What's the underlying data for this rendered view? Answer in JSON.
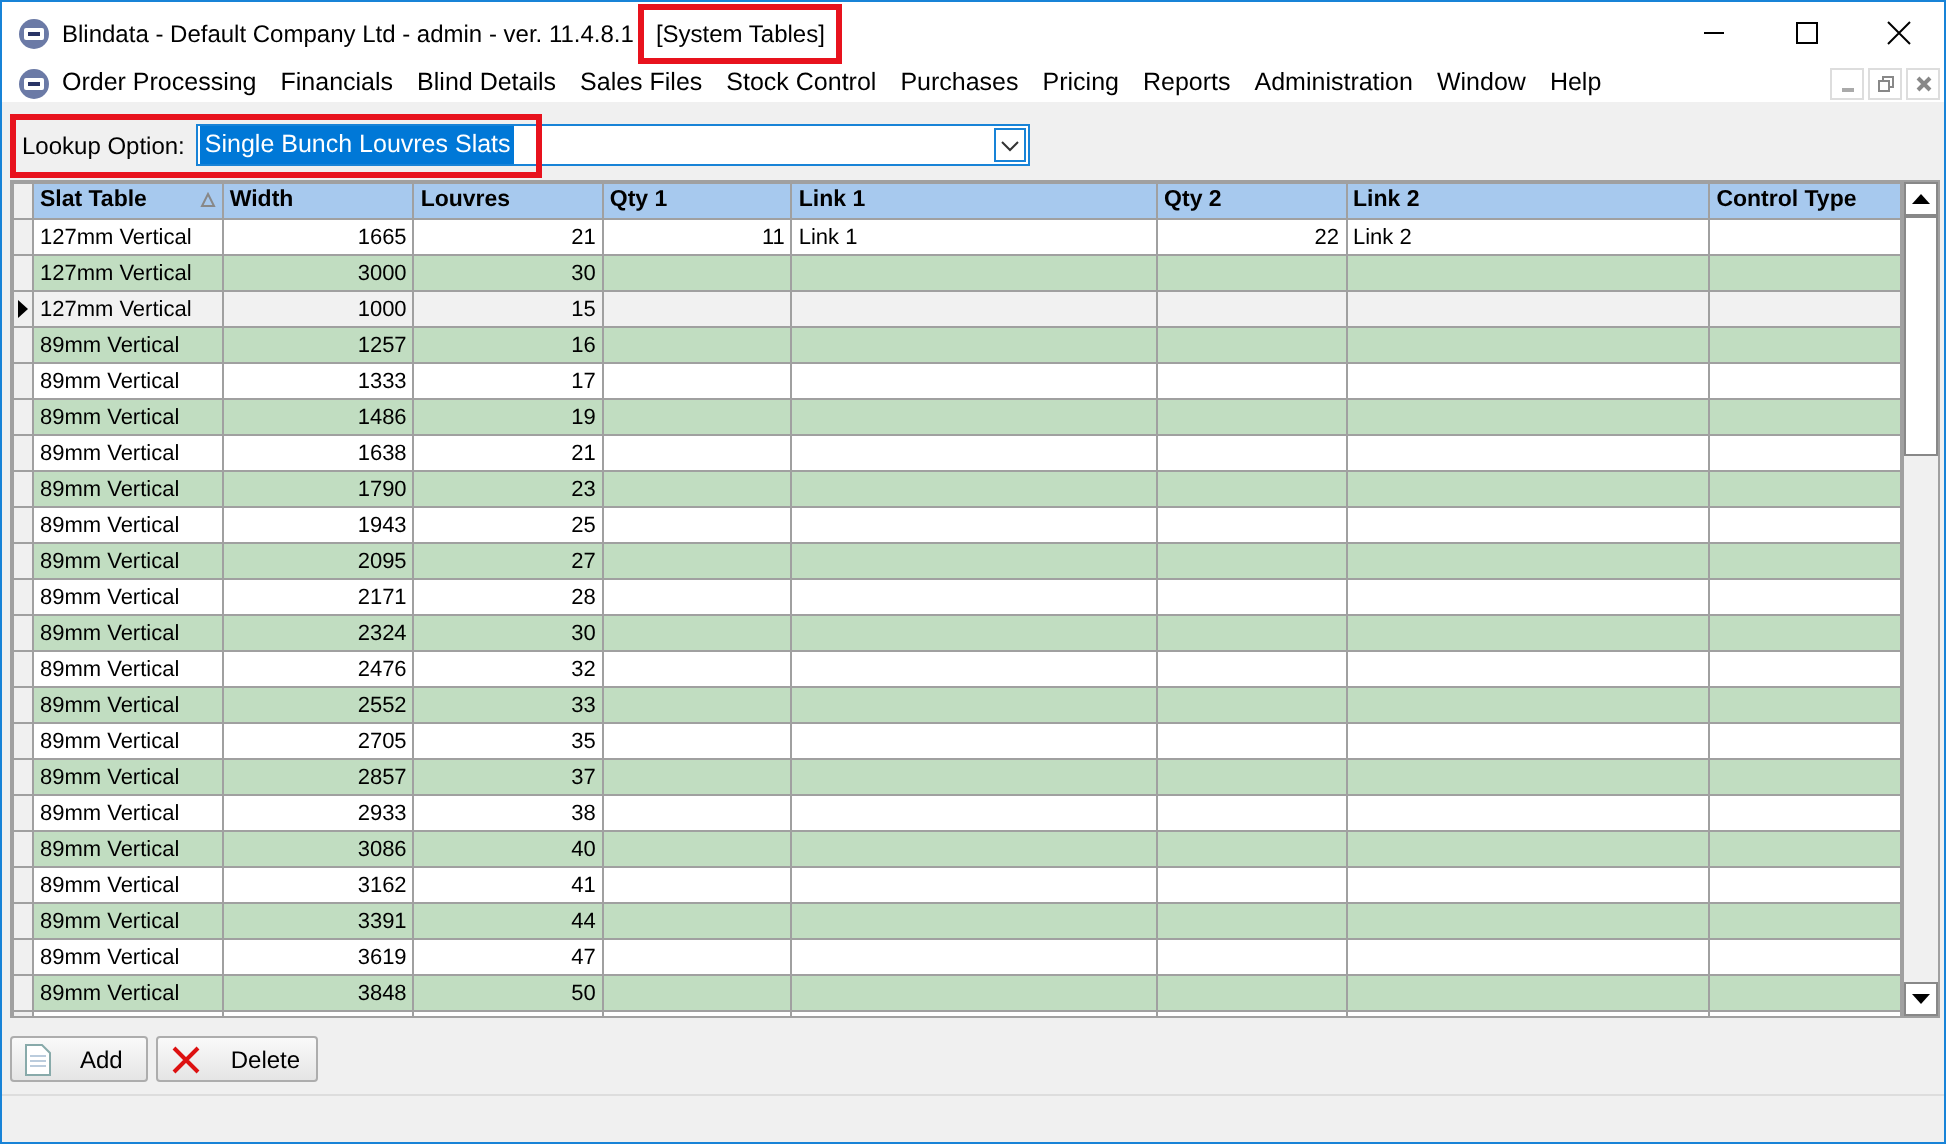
{
  "window": {
    "title": "Blindata - Default Company Ltd - admin - ver. 11.4.8.1",
    "title_tag": "[System Tables]",
    "title_tag_highlighted": true
  },
  "menu": [
    "Order Processing",
    "Financials",
    "Blind Details",
    "Sales Files",
    "Stock Control",
    "Purchases",
    "Pricing",
    "Reports",
    "Administration",
    "Window",
    "Help"
  ],
  "lookup": {
    "label": "Lookup Option:",
    "value": "Single Bunch Louvres Slats",
    "highlighted": true
  },
  "table": {
    "columns": [
      {
        "label": "Slat Table",
        "sorted": true
      },
      {
        "label": "Width",
        "sorted": false
      },
      {
        "label": "Louvres",
        "sorted": false
      },
      {
        "label": "Qty 1",
        "sorted": false
      },
      {
        "label": "Link 1",
        "sorted": false
      },
      {
        "label": "Qty 2",
        "sorted": false
      },
      {
        "label": "Link 2",
        "sorted": false
      },
      {
        "label": "Control Type",
        "sorted": false
      }
    ],
    "rows": [
      {
        "selected": false,
        "cells": [
          "127mm Vertical",
          "1665",
          "21",
          "11",
          "Link 1",
          "22",
          "Link 2"
        ]
      },
      {
        "selected": false,
        "cells": [
          "127mm Vertical",
          "3000",
          "30"
        ]
      },
      {
        "selected": true,
        "cells": [
          "127mm Vertical",
          "1000",
          "15"
        ]
      },
      {
        "selected": false,
        "cells": [
          "89mm Vertical",
          "1257",
          "16"
        ]
      },
      {
        "selected": false,
        "cells": [
          "89mm Vertical",
          "1333",
          "17"
        ]
      },
      {
        "selected": false,
        "cells": [
          "89mm Vertical",
          "1486",
          "19"
        ]
      },
      {
        "selected": false,
        "cells": [
          "89mm Vertical",
          "1638",
          "21"
        ]
      },
      {
        "selected": false,
        "cells": [
          "89mm Vertical",
          "1790",
          "23"
        ]
      },
      {
        "selected": false,
        "cells": [
          "89mm Vertical",
          "1943",
          "25"
        ]
      },
      {
        "selected": false,
        "cells": [
          "89mm Vertical",
          "2095",
          "27"
        ]
      },
      {
        "selected": false,
        "cells": [
          "89mm Vertical",
          "2171",
          "28"
        ]
      },
      {
        "selected": false,
        "cells": [
          "89mm Vertical",
          "2324",
          "30"
        ]
      },
      {
        "selected": false,
        "cells": [
          "89mm Vertical",
          "2476",
          "32"
        ]
      },
      {
        "selected": false,
        "cells": [
          "89mm Vertical",
          "2552",
          "33"
        ]
      },
      {
        "selected": false,
        "cells": [
          "89mm Vertical",
          "2705",
          "35"
        ]
      },
      {
        "selected": false,
        "cells": [
          "89mm Vertical",
          "2857",
          "37"
        ]
      },
      {
        "selected": false,
        "cells": [
          "89mm Vertical",
          "2933",
          "38"
        ]
      },
      {
        "selected": false,
        "cells": [
          "89mm Vertical",
          "3086",
          "40"
        ]
      },
      {
        "selected": false,
        "cells": [
          "89mm Vertical",
          "3162",
          "41"
        ]
      },
      {
        "selected": false,
        "cells": [
          "89mm Vertical",
          "3391",
          "44"
        ]
      },
      {
        "selected": false,
        "cells": [
          "89mm Vertical",
          "3619",
          "47"
        ]
      },
      {
        "selected": false,
        "cells": [
          "89mm Vertical",
          "3848",
          "50"
        ]
      }
    ]
  },
  "buttons": [
    {
      "kind": "add",
      "label": "Add"
    },
    {
      "kind": "delete",
      "label": "Delete"
    }
  ]
}
